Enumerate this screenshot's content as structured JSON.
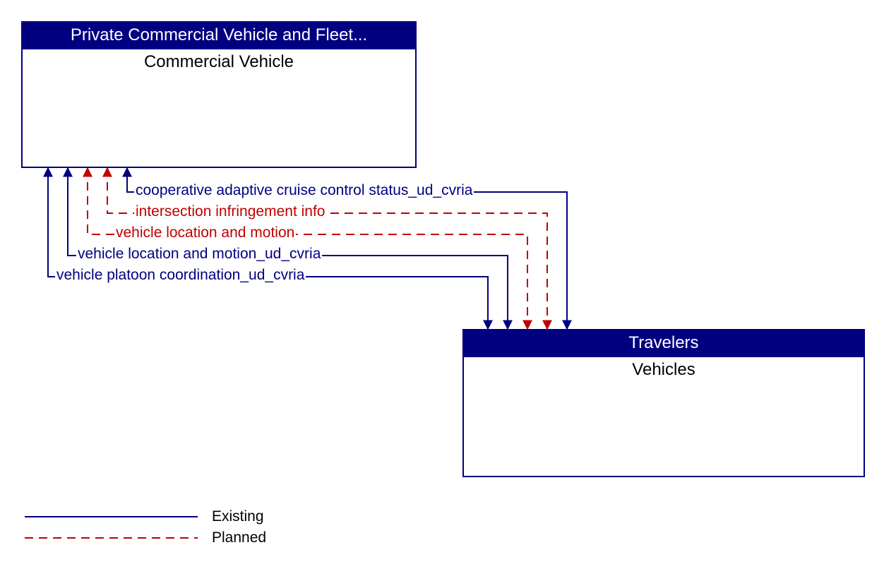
{
  "boxes": {
    "top": {
      "header": "Private Commercial Vehicle and Fleet...",
      "title": "Commercial Vehicle"
    },
    "bottom": {
      "header": "Travelers",
      "title": "Vehicles"
    }
  },
  "flows": {
    "f1": "cooperative adaptive cruise control status_ud_cvria",
    "f2": "intersection infringement info",
    "f3": "vehicle location and motion",
    "f4": "vehicle location and motion_ud_cvria",
    "f5": "vehicle platoon coordination_ud_cvria"
  },
  "legend": {
    "existing": "Existing",
    "planned": "Planned"
  },
  "colors": {
    "blue": "#000080",
    "red": "#c00000"
  }
}
